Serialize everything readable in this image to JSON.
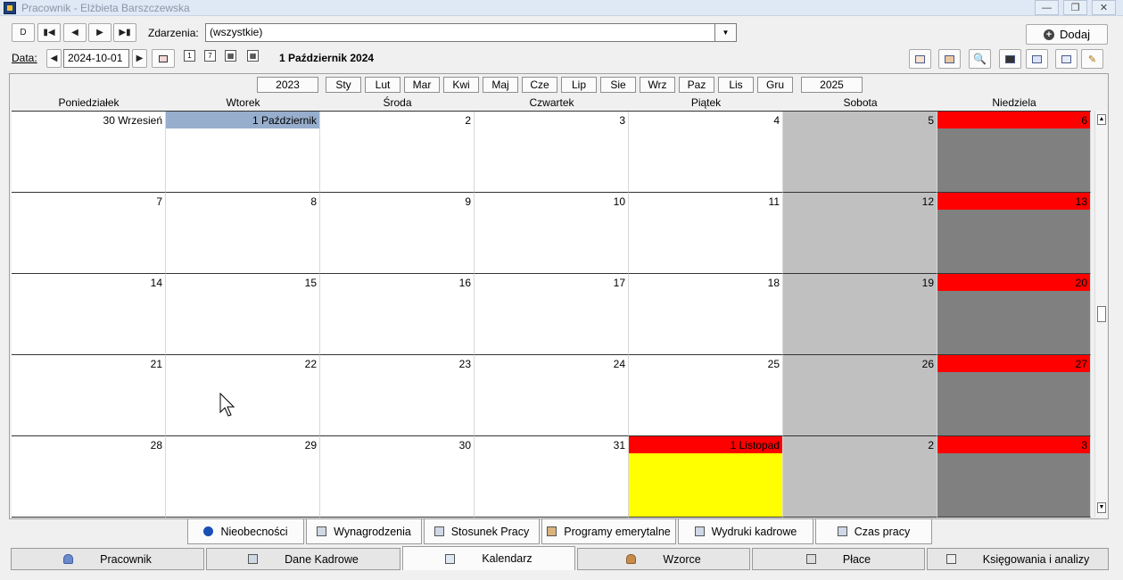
{
  "window": {
    "title": "Pracownik - Elżbieta Barszczewska"
  },
  "toolbar": {
    "nav_first": "D",
    "events_label": "Zdarzenia:",
    "events_value": "(wszystkie)",
    "add_label": "Dodaj",
    "date_label": "Data:",
    "date_value": "2024-10-01",
    "current_date": "1 Październik 2024"
  },
  "months_bar": {
    "prev_year": "2023",
    "next_year": "2025",
    "months": [
      "Sty",
      "Lut",
      "Mar",
      "Kwi",
      "Maj",
      "Cze",
      "Lip",
      "Sie",
      "Wrz",
      "Paz",
      "Lis",
      "Gru"
    ]
  },
  "weekdays": [
    "Poniedziałek",
    "Wtorek",
    "Środa",
    "Czwartek",
    "Piątek",
    "Sobota",
    "Niedziela"
  ],
  "weeks": [
    [
      {
        "label": "30 Wrzesień",
        "kind": "normal"
      },
      {
        "label": "1 Październik",
        "kind": "selected"
      },
      {
        "label": "2",
        "kind": "normal"
      },
      {
        "label": "3",
        "kind": "normal"
      },
      {
        "label": "4",
        "kind": "normal"
      },
      {
        "label": "5",
        "kind": "saturday"
      },
      {
        "label": "6",
        "kind": "sunday"
      }
    ],
    [
      {
        "label": "7",
        "kind": "normal"
      },
      {
        "label": "8",
        "kind": "normal"
      },
      {
        "label": "9",
        "kind": "normal"
      },
      {
        "label": "10",
        "kind": "normal"
      },
      {
        "label": "11",
        "kind": "normal"
      },
      {
        "label": "12",
        "kind": "saturday"
      },
      {
        "label": "13",
        "kind": "sunday"
      }
    ],
    [
      {
        "label": "14",
        "kind": "normal"
      },
      {
        "label": "15",
        "kind": "normal"
      },
      {
        "label": "16",
        "kind": "normal"
      },
      {
        "label": "17",
        "kind": "normal"
      },
      {
        "label": "18",
        "kind": "normal"
      },
      {
        "label": "19",
        "kind": "saturday"
      },
      {
        "label": "20",
        "kind": "sunday"
      }
    ],
    [
      {
        "label": "21",
        "kind": "normal"
      },
      {
        "label": "22",
        "kind": "normal"
      },
      {
        "label": "23",
        "kind": "normal"
      },
      {
        "label": "24",
        "kind": "normal"
      },
      {
        "label": "25",
        "kind": "normal"
      },
      {
        "label": "26",
        "kind": "saturday"
      },
      {
        "label": "27",
        "kind": "sunday"
      }
    ],
    [
      {
        "label": "28",
        "kind": "normal"
      },
      {
        "label": "29",
        "kind": "normal"
      },
      {
        "label": "30",
        "kind": "normal"
      },
      {
        "label": "31",
        "kind": "normal"
      },
      {
        "label": "1 Listopad",
        "kind": "holiday"
      },
      {
        "label": "2",
        "kind": "saturday"
      },
      {
        "label": "3",
        "kind": "sunday"
      }
    ]
  ],
  "colors": {
    "selected": "#97aecd",
    "saturday": "#c0c0c0",
    "sunday": "#808080",
    "red": "#ff0000",
    "holiday_body": "#ffff00"
  },
  "sub_tabs": [
    {
      "label": "Nieobecności",
      "icon": "info-icon"
    },
    {
      "label": "Wynagrodzenia",
      "icon": "wages-icon"
    },
    {
      "label": "Stosunek Pracy",
      "icon": "contract-icon"
    },
    {
      "label": "Programy emerytalne",
      "icon": "pension-icon"
    },
    {
      "label": "Wydruki kadrowe",
      "icon": "printer-icon"
    },
    {
      "label": "Czas pracy",
      "icon": "printer-icon"
    }
  ],
  "main_tabs": [
    {
      "label": "Pracownik",
      "icon": "person-icon",
      "active": false
    },
    {
      "label": "Dane Kadrowe",
      "icon": "hr-data-icon",
      "active": false
    },
    {
      "label": "Kalendarz",
      "icon": "calendar-icon",
      "active": true
    },
    {
      "label": "Wzorce",
      "icon": "templates-icon",
      "active": false
    },
    {
      "label": "Płace",
      "icon": "payroll-icon",
      "active": false
    },
    {
      "label": "Księgowania i analizy",
      "icon": "accounting-icon",
      "active": false
    }
  ]
}
